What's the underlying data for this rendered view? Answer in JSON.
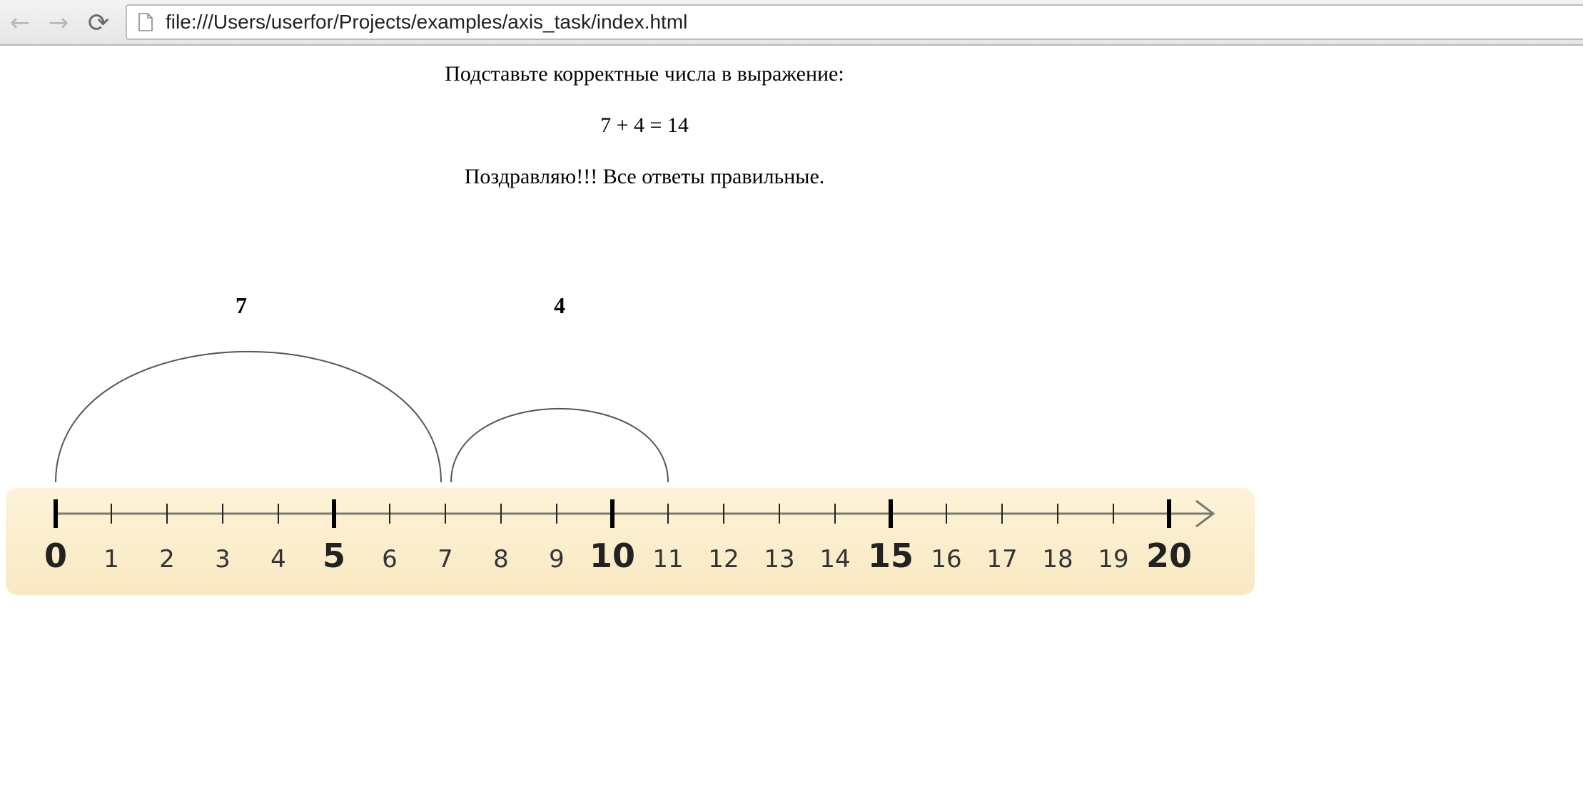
{
  "browser": {
    "url": "file:///Users/userfor/Projects/examples/axis_task/index.html",
    "back_icon": "arrow-left-icon",
    "forward_icon": "arrow-right-icon",
    "reload_icon": "reload-icon"
  },
  "page": {
    "instruction": "Подставьте корректные числа в выражение:",
    "expression": "7 + 4 = 14",
    "result_message": "Поздравляю!!! Все ответы правильные."
  },
  "number_line": {
    "min": 0,
    "max": 20,
    "major_every": 5,
    "tick_labels": [
      "0",
      "1",
      "2",
      "3",
      "4",
      "5",
      "6",
      "7",
      "8",
      "9",
      "10",
      "11",
      "12",
      "13",
      "14",
      "15",
      "16",
      "17",
      "18",
      "19",
      "20"
    ],
    "background_color": "#fdf0cf",
    "arcs": [
      {
        "from": 0,
        "to": 7,
        "label": "7"
      },
      {
        "from": 7,
        "to": 11,
        "label": "4"
      }
    ]
  }
}
